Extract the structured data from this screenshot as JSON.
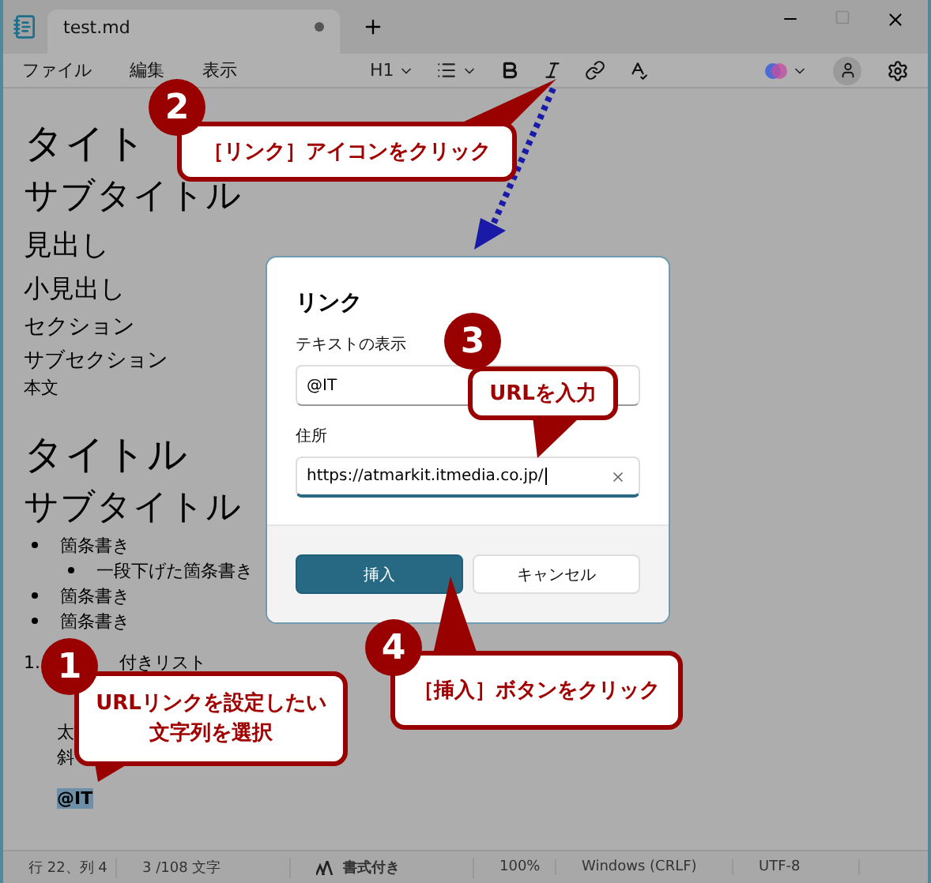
{
  "window": {
    "tab": {
      "title": "test.md",
      "unsaved": true
    }
  },
  "menu": [
    "ファイル",
    "編集",
    "表示"
  ],
  "toolbar": {
    "heading": "H1"
  },
  "document": {
    "lines": [
      {
        "kind": "title",
        "text": "タイト"
      },
      {
        "kind": "subtitle",
        "text": "サブタイトル"
      },
      {
        "kind": "h3",
        "text": "見出し"
      },
      {
        "kind": "h4",
        "text": "小見出し"
      },
      {
        "kind": "h5",
        "text": "セクション"
      },
      {
        "kind": "h6",
        "text": "サブセクション"
      },
      {
        "kind": "body",
        "text": "本文"
      },
      {
        "kind": "gap1"
      },
      {
        "kind": "title",
        "text": "タイトル"
      },
      {
        "kind": "subtitle",
        "text": "サブタイトル"
      },
      {
        "kind": "bullet",
        "text": "箇条書き"
      },
      {
        "kind": "subbullet",
        "text": "一段下げた箇条書き"
      },
      {
        "kind": "bullet",
        "text": "箇条書き"
      },
      {
        "kind": "bullet",
        "text": "箇条書き"
      },
      {
        "kind": "gap2"
      },
      {
        "kind": "numbered",
        "number": "1.",
        "text": "付きリスト"
      },
      {
        "kind": "gap3"
      },
      {
        "kind": "indented",
        "text": "太"
      },
      {
        "kind": "indented",
        "text": "斜"
      },
      {
        "kind": "gap2"
      },
      {
        "kind": "selected",
        "text": "@IT"
      }
    ]
  },
  "dialog": {
    "title": "リンク",
    "fields": [
      {
        "label": "テキストの表示",
        "value": "@IT",
        "focused": false
      },
      {
        "label": "住所",
        "value": "https://atmarkit.itmedia.co.jp/",
        "focused": true
      }
    ],
    "buttons": [
      {
        "label": "挿入",
        "primary": true
      },
      {
        "label": "キャンセル",
        "primary": false
      }
    ]
  },
  "callouts": [
    {
      "number": "2",
      "lines": [
        "［リンク］アイコンをクリック"
      ]
    },
    {
      "number": "3",
      "lines": [
        "URLを入力"
      ]
    },
    {
      "number": "4",
      "lines": [
        "［挿入］ボタンをクリック"
      ]
    },
    {
      "number": "1",
      "lines": [
        "URLリンクを設定したい",
        "文字列を選択"
      ]
    }
  ],
  "status_bar": [
    "行 22、列 4",
    "3 /108 文字",
    "書式付き",
    "100%",
    "Windows (CRLF)",
    "UTF-8"
  ]
}
